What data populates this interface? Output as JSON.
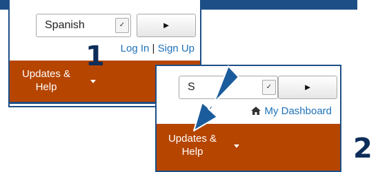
{
  "language_select": {
    "value": "Spanish"
  },
  "play_button": {
    "icon": "play-icon",
    "glyph": "►"
  },
  "panel1": {
    "auth_links": {
      "login": "Log In",
      "separator": "|",
      "signup": "Sign Up"
    },
    "nav": {
      "label_line1": "Updates &",
      "label_line2": "Help"
    }
  },
  "panel2": {
    "select_value_partial": "S",
    "dashboard_link": {
      "icon": "home-icon",
      "label": "My Dashboard"
    },
    "nav": {
      "label_line1": "Updates &",
      "label_line2": "Help"
    }
  },
  "step_labels": {
    "first": "1",
    "second": "2"
  },
  "colors": {
    "nav_background": "#b64500",
    "frame_border": "#1d4f86",
    "link": "#1e72b8",
    "callout_arrow": "#1b5c9c",
    "step_number": "#0d2d5a"
  }
}
